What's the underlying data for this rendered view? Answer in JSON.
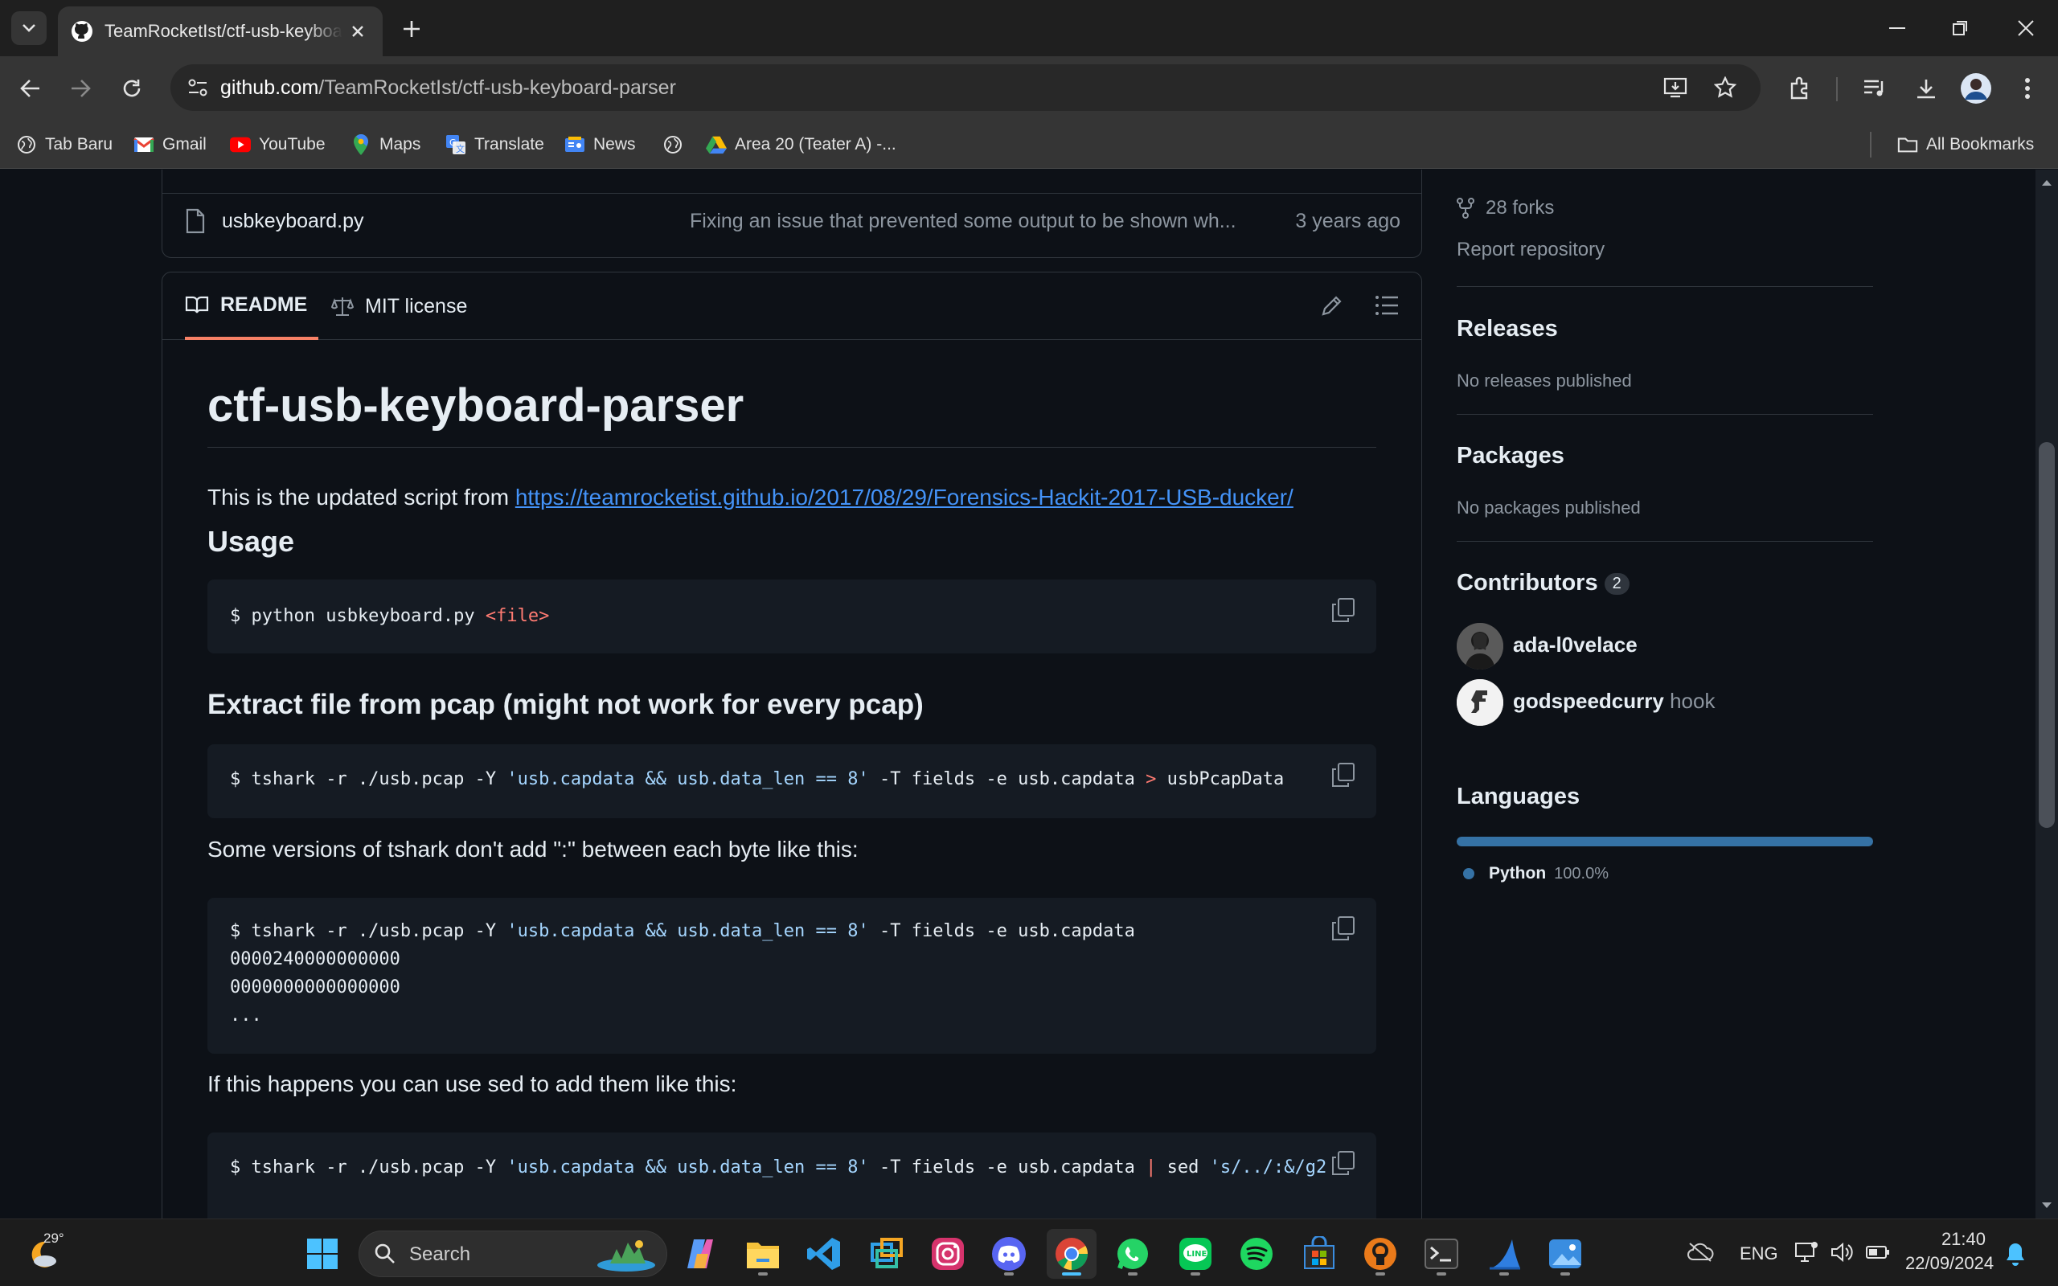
{
  "browser": {
    "tab_title": "TeamRocketIst/ctf-usb-keyboard-parser",
    "url_domain": "github.com",
    "url_path": "/TeamRocketIst/ctf-usb-keyboard-parser",
    "bookmarks": [
      "Tab Baru",
      "Gmail",
      "YouTube",
      "Maps",
      "Translate",
      "News",
      "",
      "Area 20 (Teater A) -..."
    ],
    "all_bookmarks": "All Bookmarks"
  },
  "files": [
    {
      "name": "usbkeyboard.py",
      "message": "Fixing an issue that prevented some output to be shown wh...",
      "date": "3 years ago"
    }
  ],
  "readme": {
    "tab_readme": "README",
    "tab_license": "MIT license",
    "title": "ctf-usb-keyboard-parser",
    "intro": "This is the updated script from ",
    "intro_link": "https://teamrocketist.github.io/2017/08/29/Forensics-Hackit-2017-USB-ducker/",
    "h_usage": "Usage",
    "usage_cmd_a": "$ python usbkeyboard.py ",
    "usage_cmd_b": "<file>",
    "h_extract": "Extract file from pcap (might not work for every pcap)",
    "cmd1_a": "$ tshark -r ./usb.pcap -Y ",
    "cmd1_str": "'usb.capdata && usb.data_len == 8'",
    "cmd1_b": " -T fields -e usb.capdata ",
    "cmd1_op": ">",
    "cmd1_c": " usbPcapData",
    "p_versions": "Some versions of tshark don't add \":\" between each byte like this:",
    "cmd2_a": "$ tshark -r ./usb.pcap -Y ",
    "cmd2_str": "'usb.capdata && usb.data_len == 8'",
    "cmd2_b": " -T fields -e usb.capdata",
    "cmd2_l2": "0000240000000000",
    "cmd2_l3": "0000000000000000",
    "cmd2_l4": "...",
    "p_sed": "If this happens you can use sed to add them like this:",
    "cmd3_a": "$ tshark -r ./usb.pcap -Y ",
    "cmd3_str": "'usb.capdata && usb.data_len == 8'",
    "cmd3_b": " -T fields -e usb.capdata ",
    "cmd3_op": "|",
    "cmd3_c": " sed ",
    "cmd3_str2": "'s/../:&/g2"
  },
  "sidebar": {
    "forks": "28 forks",
    "report": "Report repository",
    "releases_h": "Releases",
    "releases_t": "No releases published",
    "packages_h": "Packages",
    "packages_t": "No packages published",
    "contributors_h": "Contributors",
    "contributors_count": "2",
    "contributors": [
      {
        "name": "ada-l0velace",
        "extra": ""
      },
      {
        "name": "godspeedcurry",
        "extra": "hook"
      }
    ],
    "languages_h": "Languages",
    "language": "Python",
    "language_pct": "100.0%",
    "python_share": 1.0,
    "python_color": "#3572A5"
  },
  "taskbar": {
    "weather": "29°",
    "search": "Search",
    "lang": "ENG",
    "time": "21:40",
    "date": "22/09/2024"
  }
}
